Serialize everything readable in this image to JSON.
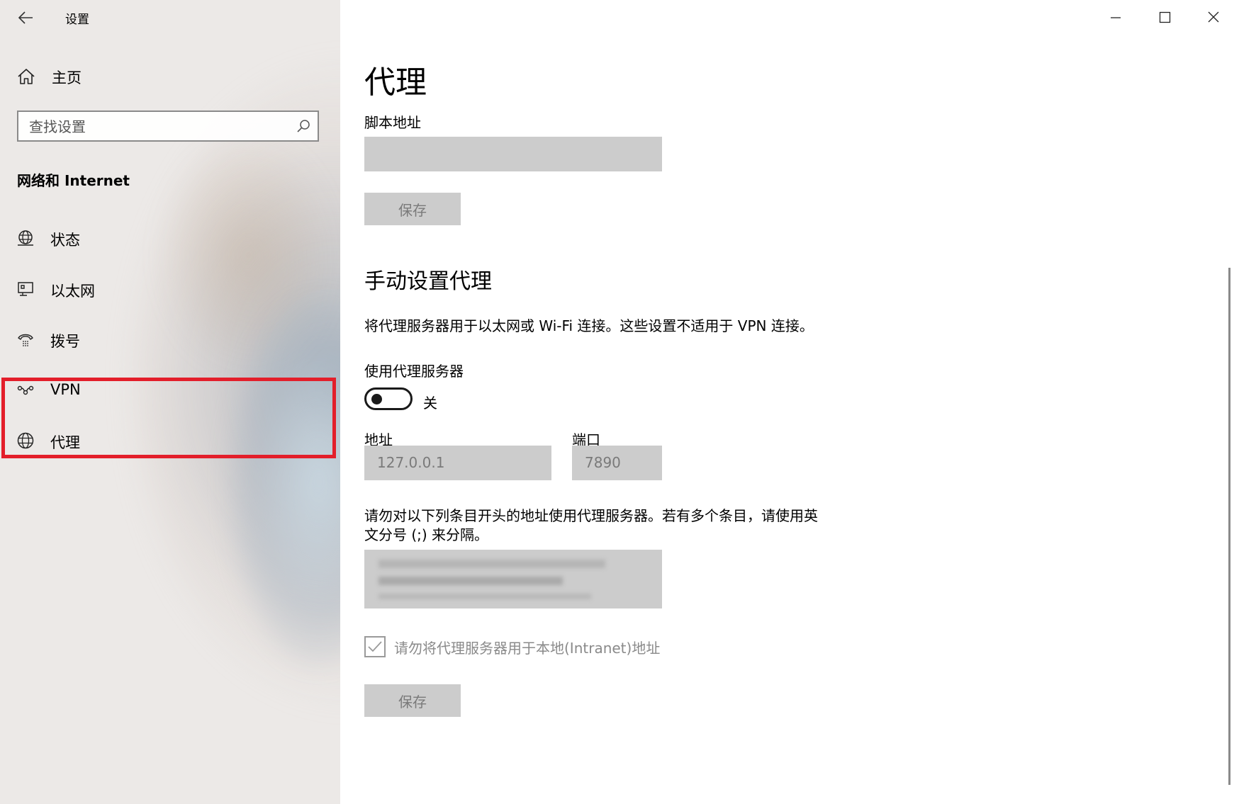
{
  "window": {
    "title": "设置"
  },
  "sidebar": {
    "home_label": "主页",
    "search_placeholder": "查找设置",
    "section_title": "网络和 Internet",
    "items": [
      {
        "label": "状态",
        "icon": "globe-status-icon"
      },
      {
        "label": "以太网",
        "icon": "ethernet-icon"
      },
      {
        "label": "拨号",
        "icon": "dialup-icon"
      },
      {
        "label": "VPN",
        "icon": "vpn-icon"
      },
      {
        "label": "代理",
        "icon": "globe-icon"
      }
    ],
    "highlight_color": "#e31e2a"
  },
  "content": {
    "page_title": "代理",
    "script_address_label": "脚本地址",
    "script_save_label": "保存",
    "manual_heading": "手动设置代理",
    "manual_description": "将代理服务器用于以太网或 Wi-Fi 连接。这些设置不适用于 VPN 连接。",
    "use_proxy_label": "使用代理服务器",
    "toggle_state": "关",
    "address_label": "地址",
    "address_value": "127.0.0.1",
    "port_label": "端口",
    "port_value": "7890",
    "exceptions_description_line1": "请勿对以下列条目开头的地址使用代理服务器。若有多个条目，请使用英",
    "exceptions_description_line2": "文分号 (;) 来分隔。",
    "local_bypass_label": "请勿将代理服务器用于本地(Intranet)地址",
    "manual_save_label": "保存"
  }
}
